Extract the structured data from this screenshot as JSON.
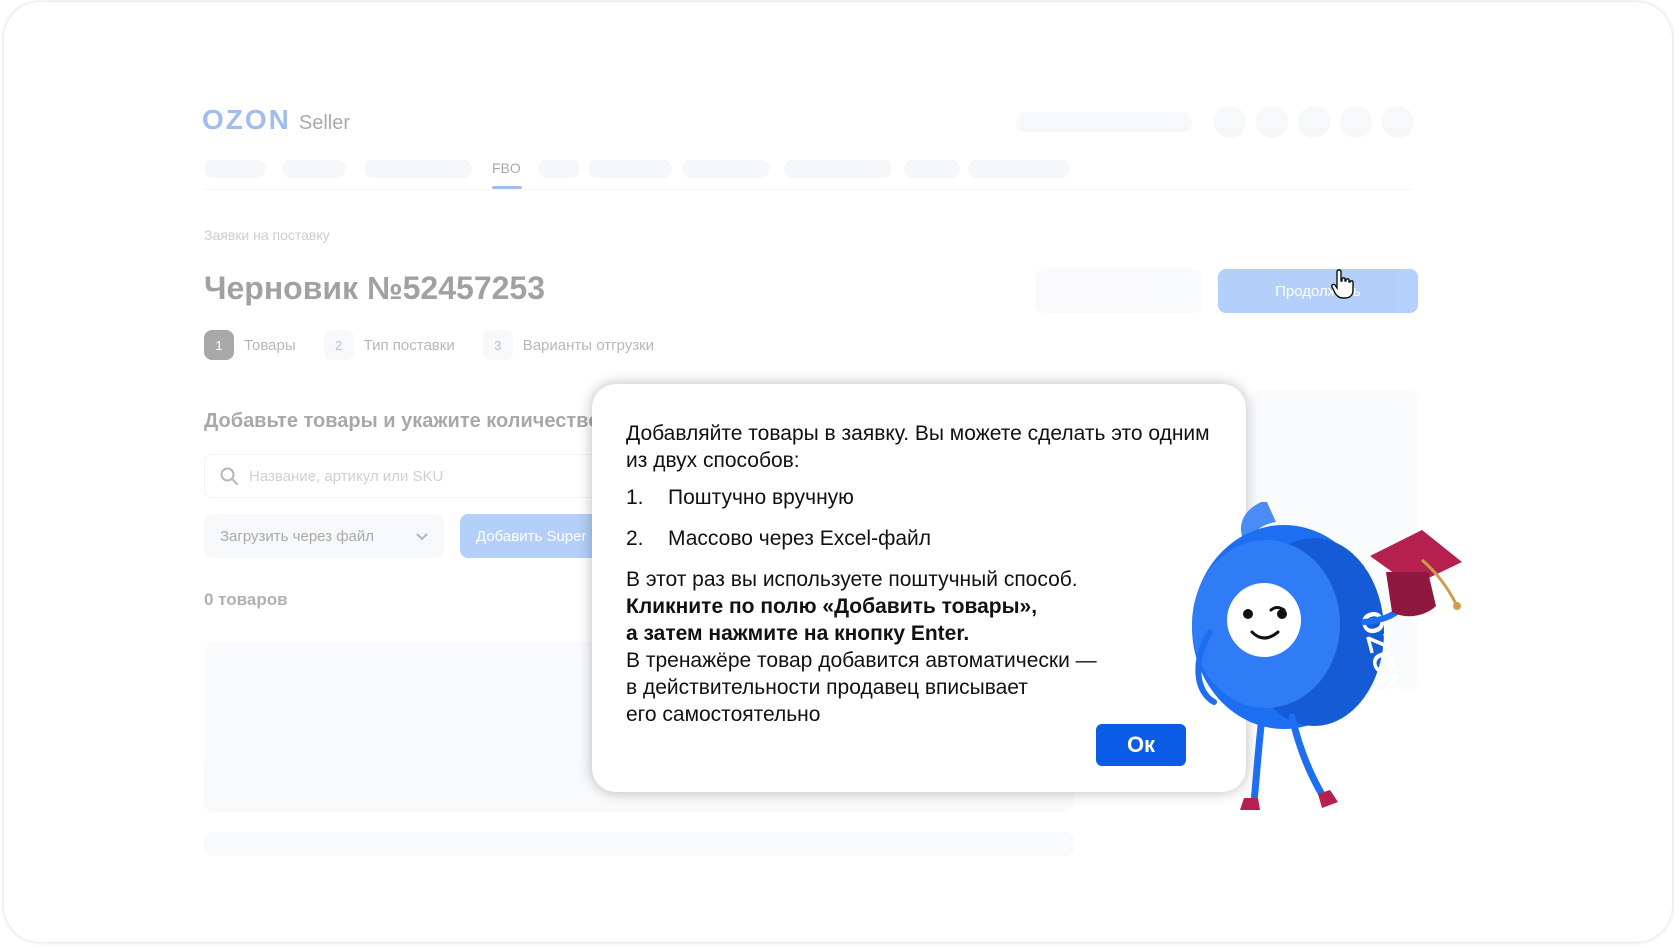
{
  "header": {
    "logo_brand": "OZON",
    "logo_product": "Seller",
    "active_tab": "FBO"
  },
  "page": {
    "breadcrumb": "Заявки на поставку",
    "title": "Черновик №52457253",
    "continue_button": "Продолжить"
  },
  "steps": [
    {
      "num": "1",
      "label": "Товары"
    },
    {
      "num": "2",
      "label": "Тип поставки"
    },
    {
      "num": "3",
      "label": "Варианты отгрузки"
    }
  ],
  "content": {
    "section_title": "Добавьте товары и укажите количество",
    "search_placeholder": "Название, артикул или SKU",
    "upload_label": "Загрузить через файл",
    "add_button": "Добавить Super",
    "count": "0 товаров"
  },
  "dialog": {
    "intro": "Добавляйте товары в заявку. Вы можете сделать это одним из двух способов:",
    "items": [
      {
        "num": "1.",
        "text": "Поштучно вручную"
      },
      {
        "num": "2.",
        "text": "Массово через Excel-файл"
      }
    ],
    "line1": "В этот раз вы используете поштучный способ.",
    "bold1": "Кликните по полю «Добавить товары»,",
    "bold2": "а затем нажмите на кнопку Enter.",
    "line2": "В тренажёре товар добавится автоматически —",
    "line3": "в действительности продавец вписывает",
    "line4": "его самостоятельно",
    "ok_button": "Ок"
  },
  "mascot": {
    "ring_text": "OZON"
  },
  "colors": {
    "brand_blue": "#1d63d6",
    "button_blue": "#0a5be6",
    "mascot_blue": "#1e6ef2",
    "hat": "#b5204f"
  }
}
